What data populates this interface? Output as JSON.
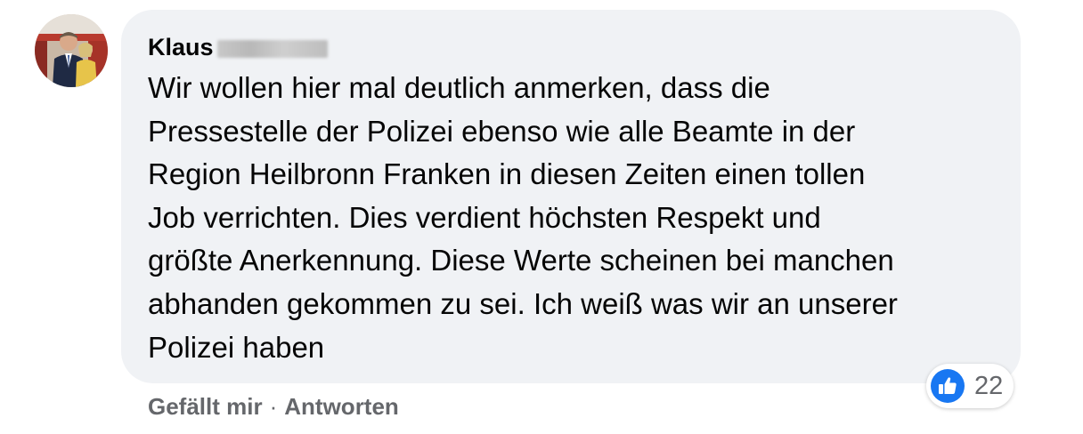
{
  "comment": {
    "author": "Klaus",
    "text": "Wir wollen hier mal deutlich anmerken, dass die\nPressestelle der Polizei ebenso wie alle Beamte in der\nRegion Heilbronn Franken in diesen Zeiten einen tollen\nJob verrichten. Dies verdient höchsten Respekt und\ngrößte Anerkennung. Diese Werte scheinen bei manchen\nabhanden gekommen zu sei. Ich weiß was wir an unserer\nPolizei haben",
    "actions": {
      "like_label": "Gefällt mir",
      "separator": "·",
      "reply_label": "Antworten"
    },
    "reactions": {
      "icon": "thumbs-up-icon",
      "count": "22",
      "color": "#1877f2"
    }
  },
  "colors": {
    "bubble_bg": "#f0f2f5",
    "text": "#050505",
    "secondary_text": "#65676b",
    "like_blue": "#1877f2"
  }
}
